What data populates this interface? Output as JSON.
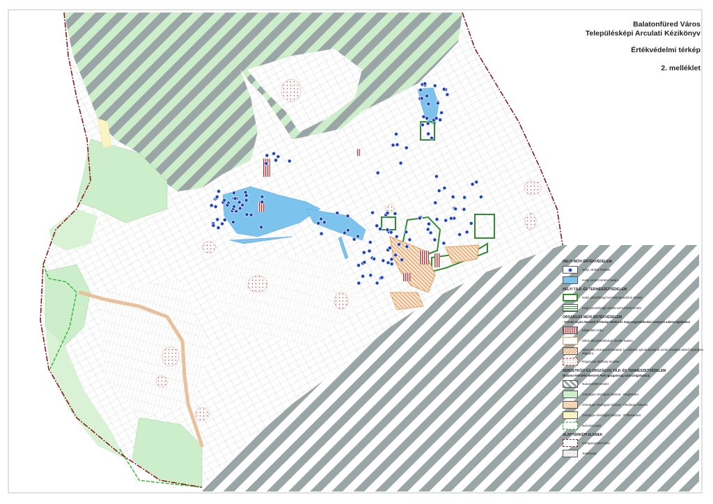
{
  "title": {
    "line1": "Balatonfüred Város",
    "line2": "Településképi Arculati Kézikönyv",
    "line3": "Értékvédelmi térkép",
    "line4": "2. melléklet"
  },
  "colors": {
    "natura": "#9aa5a5",
    "green_core": "#cdeecb",
    "green_hatch": "#2e8b2e",
    "blue_area": "#7cc4ee",
    "marker": "#1d3fb8",
    "monument": "#c23a3a",
    "corridor": "#e8c09a",
    "boundary": "#8b1a1a",
    "park_line": "#29b729"
  },
  "legend": {
    "sections": [
      {
        "heading": "HELYI MŰVI ÉRTÉKVÉDELEM",
        "items": [
          {
            "label": "Helyi védett értékek",
            "icon": "marker-icon"
          },
          {
            "label": "Helyi védett terület határa",
            "icon": "blue-area-swatch"
          }
        ]
      },
      {
        "heading": "HELYI TÁJI- ÉS TERMÉSZETVÉDELEM",
        "items": [
          {
            "label": "Helyi jelentőségű természetvédelmi terület",
            "icon": "green-box-swatch"
          },
          {
            "label": "Helyi jelentőségű védett természeti emlék",
            "icon": "green-lines-swatch"
          }
        ]
      },
      {
        "heading": "ORSZÁGOS MŰVI ÉRTÉKVÉDELEM",
        "subheading": "- Forster Gyula Nemzeti Örökségvédelmi és Vagyongazdálkodási Központ adatszolgáltatása",
        "items": [
          {
            "label": "Műemléki telke",
            "icon": "monument-swatch"
          },
          {
            "label": "Műemléki jelentőségű terület határa",
            "icon": "orange-border-swatch"
          },
          {
            "label": "Műemléki környezet területe  (a védettő nyilvántartásról szóló rendelet eltérő kijelölése alapján)",
            "icon": "orange-hatch-swatch"
          },
          {
            "label": "Régészeti lelőhely területe",
            "icon": "dots-swatch"
          }
        ]
      },
      {
        "heading": "NEMZETKÖZI ÉS ORSZÁGOS TÁJI- ÉS TERMÉSZETVÉDELEM",
        "subheading": "(Balaton-felvidéki Nemzeti Park Igazgatóság adatszolgáltatása)",
        "items": [
          {
            "label": "Natura2000 terület",
            "icon": "natura-swatch"
          },
          {
            "label": "Országos ökológiai hálózat - Magterület",
            "icon": "core-swatch"
          },
          {
            "label": "Országos ökológiai hálózat - Ökológiai folyosó",
            "icon": "corridor-swatch"
          },
          {
            "label": "Országos ökológiai hálózat - Pufferterület",
            "icon": "buffer-swatch"
          },
          {
            "label": "Nemzeti park",
            "icon": "park-swatch"
          }
        ]
      },
      {
        "heading": "ALAPTÉRKÉPI ELEMEK",
        "items": [
          {
            "label": "Közigazgatási határ",
            "icon": "boundary-swatch"
          },
          {
            "label": "Telekhatár",
            "icon": "parcel-swatch"
          }
        ]
      }
    ]
  }
}
